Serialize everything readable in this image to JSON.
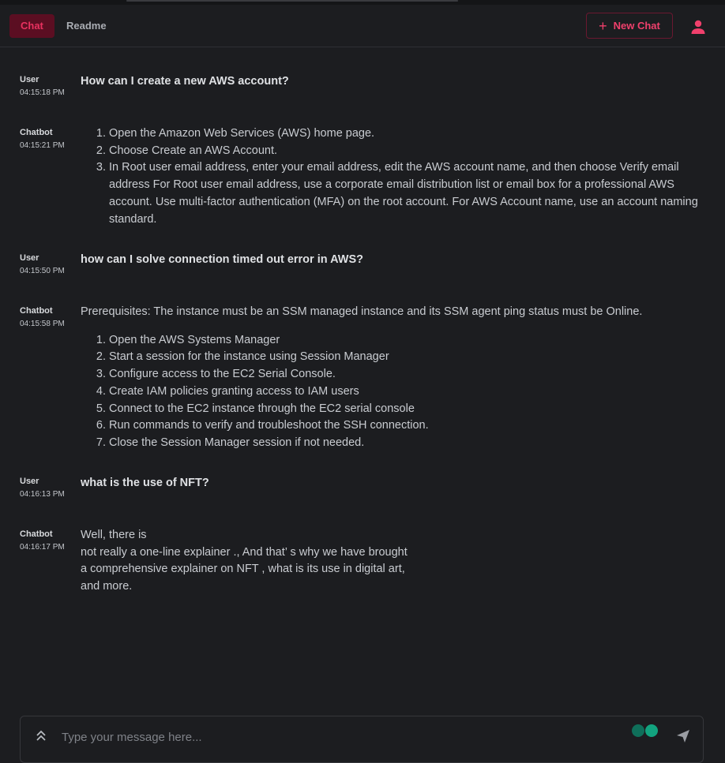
{
  "header": {
    "tabs": [
      {
        "label": "Chat",
        "active": true
      },
      {
        "label": "Readme",
        "active": false
      }
    ],
    "new_chat_label": "New Chat",
    "accent_color": "#f0406c"
  },
  "messages": [
    {
      "role": "User",
      "time": "04:15:18 PM",
      "text": "How can I create a new AWS account?"
    },
    {
      "role": "Chatbot",
      "time": "04:15:21 PM",
      "steps": [
        "Open the Amazon Web Services (AWS) home page.",
        "Choose Create an AWS Account.",
        "In Root user email address, enter your email address, edit the AWS account name, and then choose Verify email address For Root user email address, use a corporate email distribution list or email box for a professional AWS account. Use multi-factor authentication (MFA) on the root account. For AWS Account name, use an account naming standard."
      ]
    },
    {
      "role": "User",
      "time": "04:15:50 PM",
      "text": "how can I solve connection timed out error in AWS?"
    },
    {
      "role": "Chatbot",
      "time": "04:15:58 PM",
      "intro": "Prerequisites: The instance must be an SSM managed instance and its SSM agent ping status must be Online.",
      "steps": [
        "Open the AWS Systems Manager",
        "Start a session for the instance using Session Manager",
        "Configure access to the EC2 Serial Console.",
        "Create IAM policies granting access to IAM users",
        "Connect to the EC2 instance through the EC2 serial console",
        "Run commands to verify and troubleshoot the SSH connection.",
        "Close the Session Manager session if not needed."
      ]
    },
    {
      "role": "User",
      "time": "04:16:13 PM",
      "text": "what is the use of NFT?"
    },
    {
      "role": "Chatbot",
      "time": "04:16:17 PM",
      "lines": [
        "Well, there is",
        "not really a one-line explainer ., And that’ s why we have brought",
        "a comprehensive explainer on NFT , what is its use in digital art,",
        "and more."
      ]
    }
  ],
  "composer": {
    "placeholder": "Type your message here..."
  },
  "icons": {
    "new_chat": "plus-icon",
    "profile": "user-icon",
    "expand": "chevrons-up-icon",
    "send": "send-icon",
    "extensions": "grammarly-icon"
  }
}
